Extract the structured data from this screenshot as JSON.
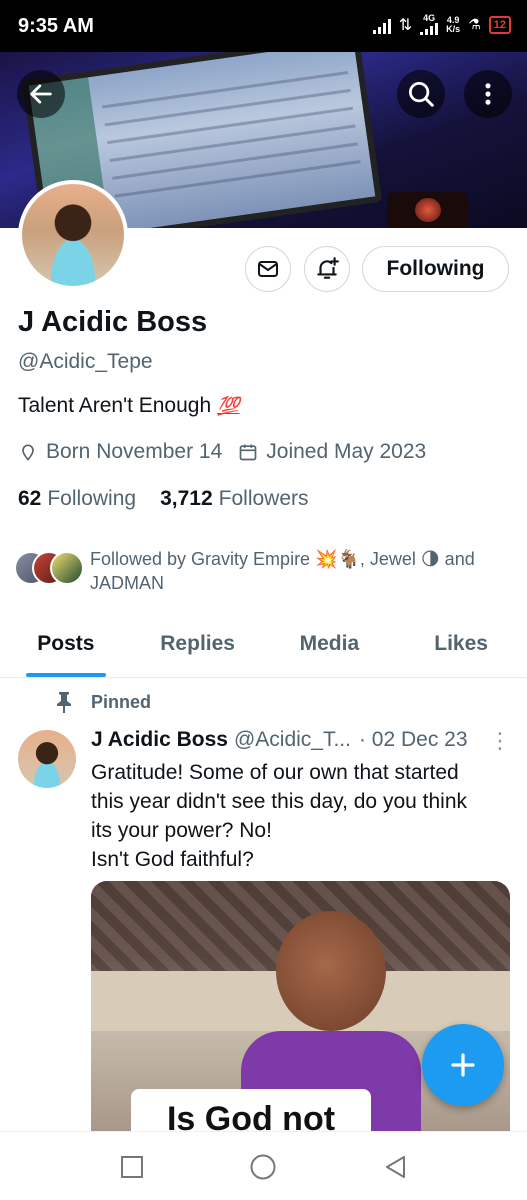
{
  "status_bar": {
    "time": "9:35 AM",
    "network_type": "4G",
    "speed_value": "4.9",
    "speed_unit": "K/s",
    "battery": "12"
  },
  "header": {
    "back_icon": "arrow-left-icon",
    "search_icon": "search-icon",
    "more_icon": "more-vertical-icon"
  },
  "profile": {
    "name": "J Acidic Boss",
    "handle": "@Acidic_Tepe",
    "bio": "Talent Aren't Enough",
    "bio_emoji": "💯",
    "born": "Born November 14",
    "joined": "Joined May 2023",
    "following_count": "62",
    "following_label": "Following",
    "followers_count": "3,712",
    "followers_label": "Followers",
    "followed_by": "Followed by Gravity Empire 💥🐐, Jewel 🌗 and JADMAN",
    "follow_button": "Following"
  },
  "tabs": [
    {
      "label": "Posts",
      "active": true
    },
    {
      "label": "Replies",
      "active": false
    },
    {
      "label": "Media",
      "active": false
    },
    {
      "label": "Likes",
      "active": false
    }
  ],
  "post": {
    "pinned_label": "Pinned",
    "author_name": "J Acidic Boss",
    "author_handle": "@Acidic_T...",
    "date": "· 02 Dec 23",
    "lines": [
      "Gratitude! Some of our own that started",
      "this year  didn't see this day, do you think",
      "its your power? No!",
      "Isn't God faithful?"
    ],
    "image_caption": "Is God not"
  },
  "fab_icon": "plus-icon",
  "colors": {
    "accent": "#1d9bf0",
    "secondary_text": "#536471",
    "primary_text": "#0f1419"
  }
}
